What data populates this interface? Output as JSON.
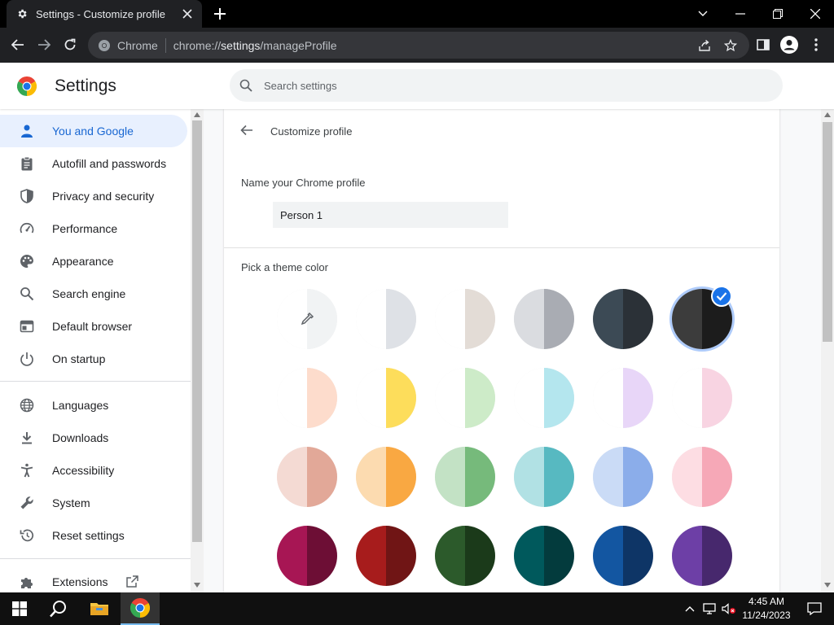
{
  "browser": {
    "tab_title": "Settings - Customize profile",
    "omnibox_brand": "Chrome",
    "url_prefix": "chrome://",
    "url_host": "settings",
    "url_path": "/manageProfile"
  },
  "header": {
    "title": "Settings",
    "search_placeholder": "Search settings"
  },
  "sidebar": {
    "items": [
      {
        "label": "You and Google",
        "icon": "person-icon",
        "active": true
      },
      {
        "label": "Autofill and passwords",
        "icon": "clipboard-icon"
      },
      {
        "label": "Privacy and security",
        "icon": "shield-icon"
      },
      {
        "label": "Performance",
        "icon": "speedometer-icon"
      },
      {
        "label": "Appearance",
        "icon": "palette-icon"
      },
      {
        "label": "Search engine",
        "icon": "search-icon"
      },
      {
        "label": "Default browser",
        "icon": "browser-window-icon"
      },
      {
        "label": "On startup",
        "icon": "power-icon"
      },
      {
        "label": "Languages",
        "icon": "globe-icon"
      },
      {
        "label": "Downloads",
        "icon": "download-icon"
      },
      {
        "label": "Accessibility",
        "icon": "accessibility-icon"
      },
      {
        "label": "System",
        "icon": "wrench-icon"
      },
      {
        "label": "Reset settings",
        "icon": "reset-icon"
      },
      {
        "label": "Extensions",
        "icon": "puzzle-icon"
      }
    ]
  },
  "main": {
    "title": "Customize profile",
    "name_label": "Name your Chrome profile",
    "name_value": "Person 1",
    "theme_label": "Pick a theme color",
    "swatches": [
      {
        "left": "#ffffff",
        "right": "#f1f3f4",
        "kind": "picker"
      },
      {
        "left": "#ffffff",
        "right": "#dee1e6"
      },
      {
        "left": "#ffffff",
        "right": "#e3dcd6"
      },
      {
        "left": "#dadce0",
        "right": "#a9acb3"
      },
      {
        "left": "#3c4a55",
        "right": "#2b3137"
      },
      {
        "left": "#3c3c3c",
        "right": "#1c1c1c",
        "selected": true
      },
      {
        "left": "#ffffff",
        "right": "#fddccc"
      },
      {
        "left": "#ffffff",
        "right": "#fddd5b"
      },
      {
        "left": "#ffffff",
        "right": "#cdebc8"
      },
      {
        "left": "#ffffff",
        "right": "#b4e6ee"
      },
      {
        "left": "#ffffff",
        "right": "#e8d6f8"
      },
      {
        "left": "#ffffff",
        "right": "#f8d4e2"
      },
      {
        "left": "#f4dad3",
        "right": "#e2a898"
      },
      {
        "left": "#fcdbb0",
        "right": "#f9a842"
      },
      {
        "left": "#c3e2c5",
        "right": "#76ba7b"
      },
      {
        "left": "#b1e1e4",
        "right": "#57b9c1"
      },
      {
        "left": "#cadbf6",
        "right": "#8badea"
      },
      {
        "left": "#fddde3",
        "right": "#f6a8b7"
      },
      {
        "left": "#a71654",
        "right": "#6d0e35"
      },
      {
        "left": "#a71c1c",
        "right": "#701515"
      },
      {
        "left": "#2c5a2b",
        "right": "#1b3a1a"
      },
      {
        "left": "#00595c",
        "right": "#033b3d"
      },
      {
        "left": "#1356a1",
        "right": "#0e3566"
      },
      {
        "left": "#6d3fa6",
        "right": "#47286d"
      }
    ]
  },
  "taskbar": {
    "time": "4:45 AM",
    "date": "11/24/2023"
  },
  "colors": {
    "accent": "#1a73e8",
    "active_nav_bg": "#e8f0fe",
    "active_nav_text": "#1967d2"
  }
}
